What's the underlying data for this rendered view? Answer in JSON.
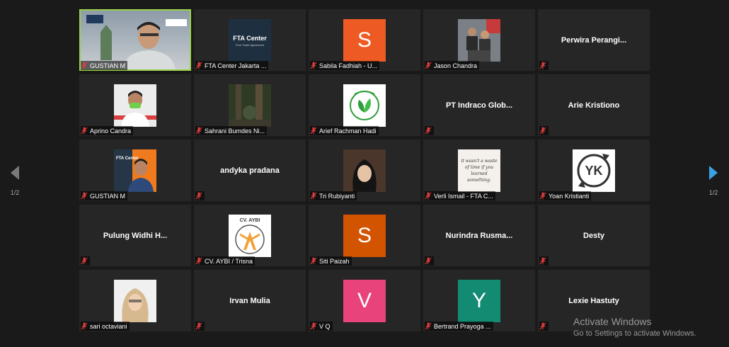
{
  "pagination": {
    "left_page": "1/2",
    "right_page": "1/2"
  },
  "participants": [
    {
      "label": "GUSTIAN M",
      "type": "video",
      "active": true
    },
    {
      "label": "FTA Center Jakarta ...",
      "type": "logo-fta",
      "logo_title": "FTA Center",
      "logo_sub": "Free Trade Agreement"
    },
    {
      "label": "Sabila Fadhiah - U...",
      "type": "letter",
      "letter": "S",
      "color": "#ee5a24"
    },
    {
      "label": "Jason Chandra",
      "type": "photo-jason"
    },
    {
      "label": "",
      "type": "name",
      "big_name": "Perwira  Perangi..."
    },
    {
      "label": "Aprino Candra",
      "type": "photo-aprino"
    },
    {
      "label": "Sahrani Bumdes Ni...",
      "type": "photo-forest"
    },
    {
      "label": "Arief Rachman Hadi",
      "type": "logo-leaf"
    },
    {
      "label": "",
      "type": "name",
      "big_name": "PT  Indraco  Glob..."
    },
    {
      "label": "",
      "type": "name",
      "big_name": "Arie Kristiono"
    },
    {
      "label": "GUSTIAN M",
      "type": "photo-gustian",
      "logo_title": "FTA Center"
    },
    {
      "label": "",
      "type": "name",
      "big_name": "andyka pradana"
    },
    {
      "label": "Tri Rubiyanti",
      "type": "photo-tri"
    },
    {
      "label": "Verli Ismail - FTA C...",
      "type": "quote",
      "quote": "it wasn't a waste of time if you learned something."
    },
    {
      "label": "Yoan Kristianti",
      "type": "logo-yk",
      "logo_text": "YK"
    },
    {
      "label": "",
      "type": "name",
      "big_name": "Pulung  Widhi  H..."
    },
    {
      "label": "CV. AYBI / Trisna",
      "type": "logo-aybi",
      "logo_text": "CV. AYBI"
    },
    {
      "label": "Siti Paizah",
      "type": "letter",
      "letter": "S",
      "color": "#d35400"
    },
    {
      "label": "",
      "type": "name",
      "big_name": "Nurindra  Rusma..."
    },
    {
      "label": "",
      "type": "name",
      "big_name": "Desty"
    },
    {
      "label": "sari octaviani",
      "type": "photo-sari"
    },
    {
      "label": "",
      "type": "name",
      "big_name": "Irvan Mulia"
    },
    {
      "label": "V Q",
      "type": "letter",
      "letter": "V",
      "color": "#e8437a"
    },
    {
      "label": "Bertrand Prayoga ...",
      "type": "letter",
      "letter": "Y",
      "color": "#138a72"
    },
    {
      "label": "",
      "type": "name",
      "big_name": "Lexie Hastuty"
    }
  ],
  "watermark": {
    "title": "Activate Windows",
    "subtitle": "Go to Settings to activate Windows."
  }
}
